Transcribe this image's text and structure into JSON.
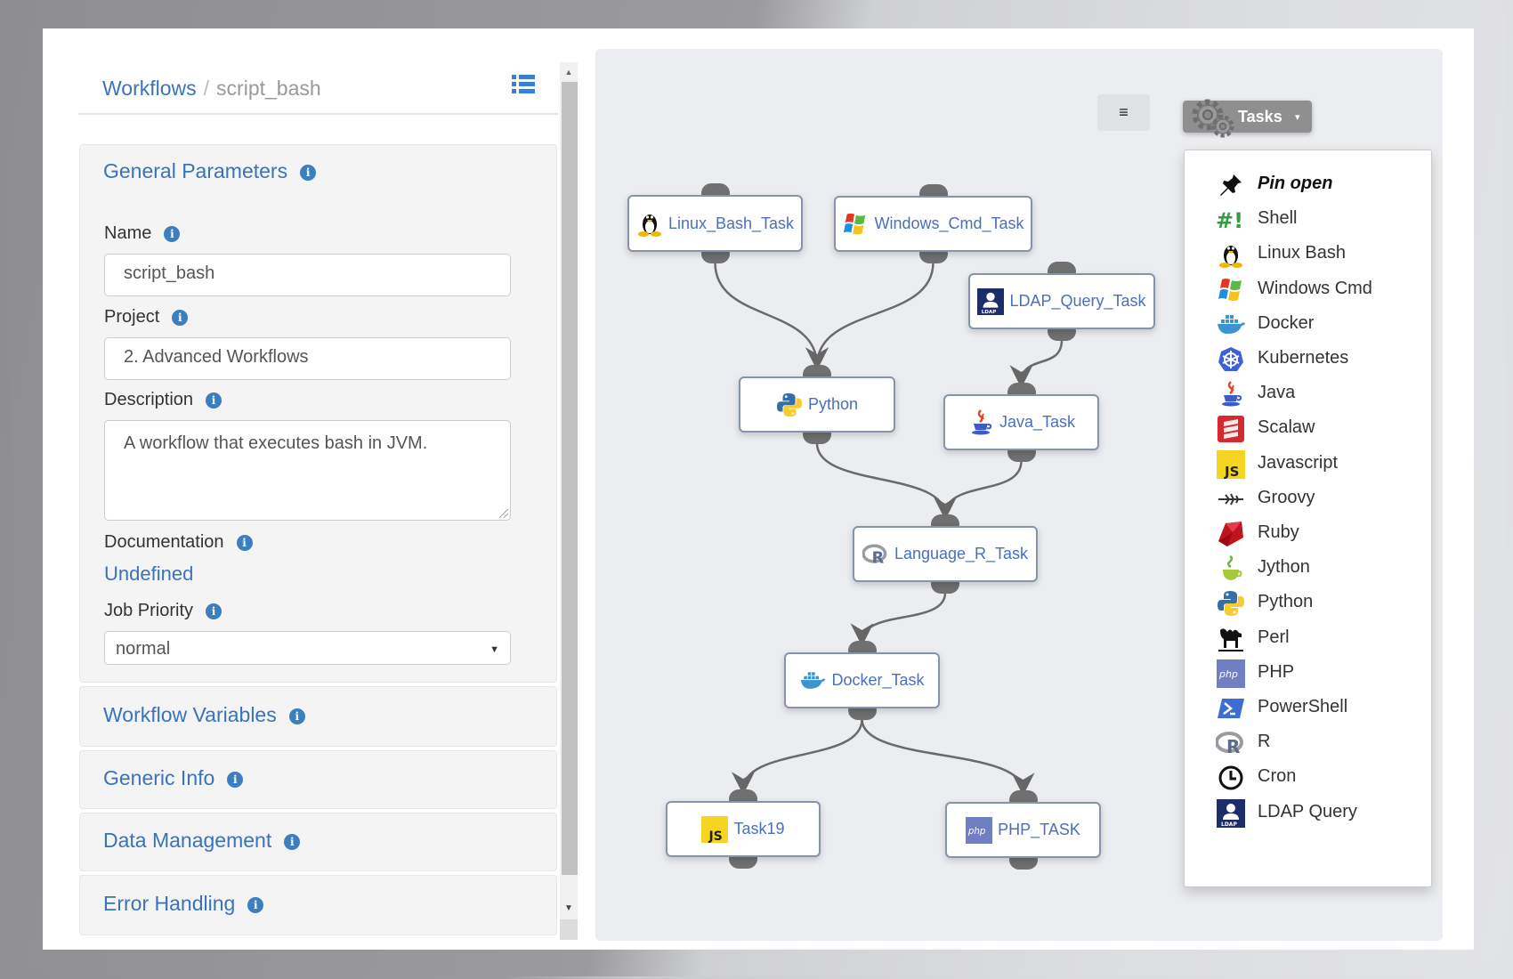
{
  "breadcrumb": {
    "root": "Workflows",
    "separator": "/",
    "current": "script_bash"
  },
  "icons": {
    "list_view": "list-icon",
    "info": "i"
  },
  "general_parameters": {
    "title": "General Parameters",
    "name_label": "Name",
    "name_value": "script_bash",
    "project_label": "Project",
    "project_value": "2. Advanced Workflows",
    "description_label": "Description",
    "description_value": "A workflow that executes bash in JVM.",
    "documentation_label": "Documentation",
    "documentation_value": "Undefined",
    "job_priority_label": "Job Priority",
    "job_priority_value": "normal"
  },
  "sections": [
    {
      "title": "Workflow Variables"
    },
    {
      "title": "Generic Info"
    },
    {
      "title": "Data Management"
    },
    {
      "title": "Error Handling"
    }
  ],
  "toolbar": {
    "format_button": "≡",
    "tasks_button": "Tasks",
    "tasks_caret": "▾"
  },
  "tasks_menu": {
    "items": [
      {
        "label": "Pin open",
        "icon": "pin-icon"
      },
      {
        "label": "Shell",
        "icon": "shell-icon"
      },
      {
        "label": "Linux Bash",
        "icon": "linux-icon"
      },
      {
        "label": "Windows Cmd",
        "icon": "windows-icon"
      },
      {
        "label": "Docker",
        "icon": "docker-icon"
      },
      {
        "label": "Kubernetes",
        "icon": "kubernetes-icon"
      },
      {
        "label": "Java",
        "icon": "java-icon"
      },
      {
        "label": "Scalaw",
        "icon": "scala-icon"
      },
      {
        "label": "Javascript",
        "icon": "javascript-icon"
      },
      {
        "label": "Groovy",
        "icon": "groovy-icon"
      },
      {
        "label": "Ruby",
        "icon": "ruby-icon"
      },
      {
        "label": "Jython",
        "icon": "jython-icon"
      },
      {
        "label": "Python",
        "icon": "python-icon"
      },
      {
        "label": "Perl",
        "icon": "perl-icon"
      },
      {
        "label": "PHP",
        "icon": "php-icon"
      },
      {
        "label": "PowerShell",
        "icon": "powershell-icon"
      },
      {
        "label": "R",
        "icon": "r-icon"
      },
      {
        "label": "Cron",
        "icon": "cron-icon"
      },
      {
        "label": "LDAP Query",
        "icon": "ldap-icon"
      }
    ]
  },
  "workflow": {
    "nodes": [
      {
        "id": "linux",
        "label": "Linux_Bash_Task",
        "icon": "linux-icon"
      },
      {
        "id": "windows",
        "label": "Windows_Cmd_Task",
        "icon": "windows-icon"
      },
      {
        "id": "ldap",
        "label": "LDAP_Query_Task",
        "icon": "ldap-icon"
      },
      {
        "id": "python",
        "label": "Python",
        "icon": "python-icon"
      },
      {
        "id": "java",
        "label": "Java_Task",
        "icon": "java-icon"
      },
      {
        "id": "r",
        "label": "Language_R_Task",
        "icon": "r-icon"
      },
      {
        "id": "docker",
        "label": "Docker_Task",
        "icon": "docker-icon"
      },
      {
        "id": "js",
        "label": "Task19",
        "icon": "javascript-icon"
      },
      {
        "id": "php",
        "label": "PHP_TASK",
        "icon": "php-icon"
      }
    ],
    "edges": [
      {
        "from": "linux",
        "to": "python"
      },
      {
        "from": "windows",
        "to": "python"
      },
      {
        "from": "ldap",
        "to": "java"
      },
      {
        "from": "python",
        "to": "r"
      },
      {
        "from": "java",
        "to": "r"
      },
      {
        "from": "r",
        "to": "docker"
      },
      {
        "from": "docker",
        "to": "js"
      },
      {
        "from": "docker",
        "to": "php"
      }
    ]
  },
  "colors": {
    "link": "#3b73b9",
    "info_badge": "#3c7fc0",
    "node_text": "#4a6fbf",
    "canvas_bg": "#ebedf0",
    "tasks_button_bg": "#8f8f8f"
  }
}
